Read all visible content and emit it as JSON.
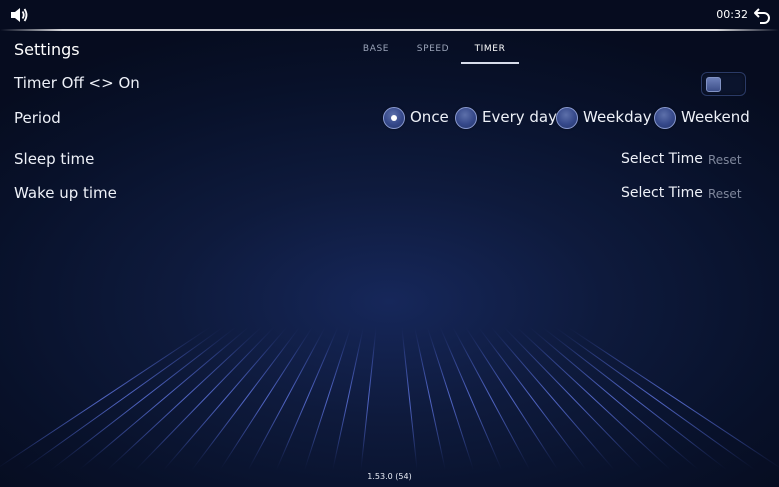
{
  "topbar": {
    "time": "00:32",
    "icons": {
      "sound": "speaker-icon",
      "back": "back-arrow-icon"
    }
  },
  "settings": {
    "title": "Settings",
    "tabs": [
      {
        "label": "BASE",
        "active": false
      },
      {
        "label": "SPEED",
        "active": false
      },
      {
        "label": "TIMER",
        "active": true
      }
    ]
  },
  "timer": {
    "toggle_label": "Timer Off <> On",
    "enabled": false,
    "period_label": "Period",
    "period_options": [
      {
        "label": "Once",
        "selected": true
      },
      {
        "label": "Every day",
        "selected": false
      },
      {
        "label": "Weekday",
        "selected": false
      },
      {
        "label": "Weekend",
        "selected": false
      }
    ],
    "sleep_label": "Sleep time",
    "sleep_value": "Select Time",
    "sleep_reset": "Reset",
    "wake_label": "Wake up time",
    "wake_value": "Select Time",
    "wake_reset": "Reset"
  },
  "footer": {
    "version": "1.53.0 (54)"
  },
  "colors": {
    "background": "#0e1a3c",
    "grid": "#5b72d6",
    "accent": "#ffffff"
  }
}
